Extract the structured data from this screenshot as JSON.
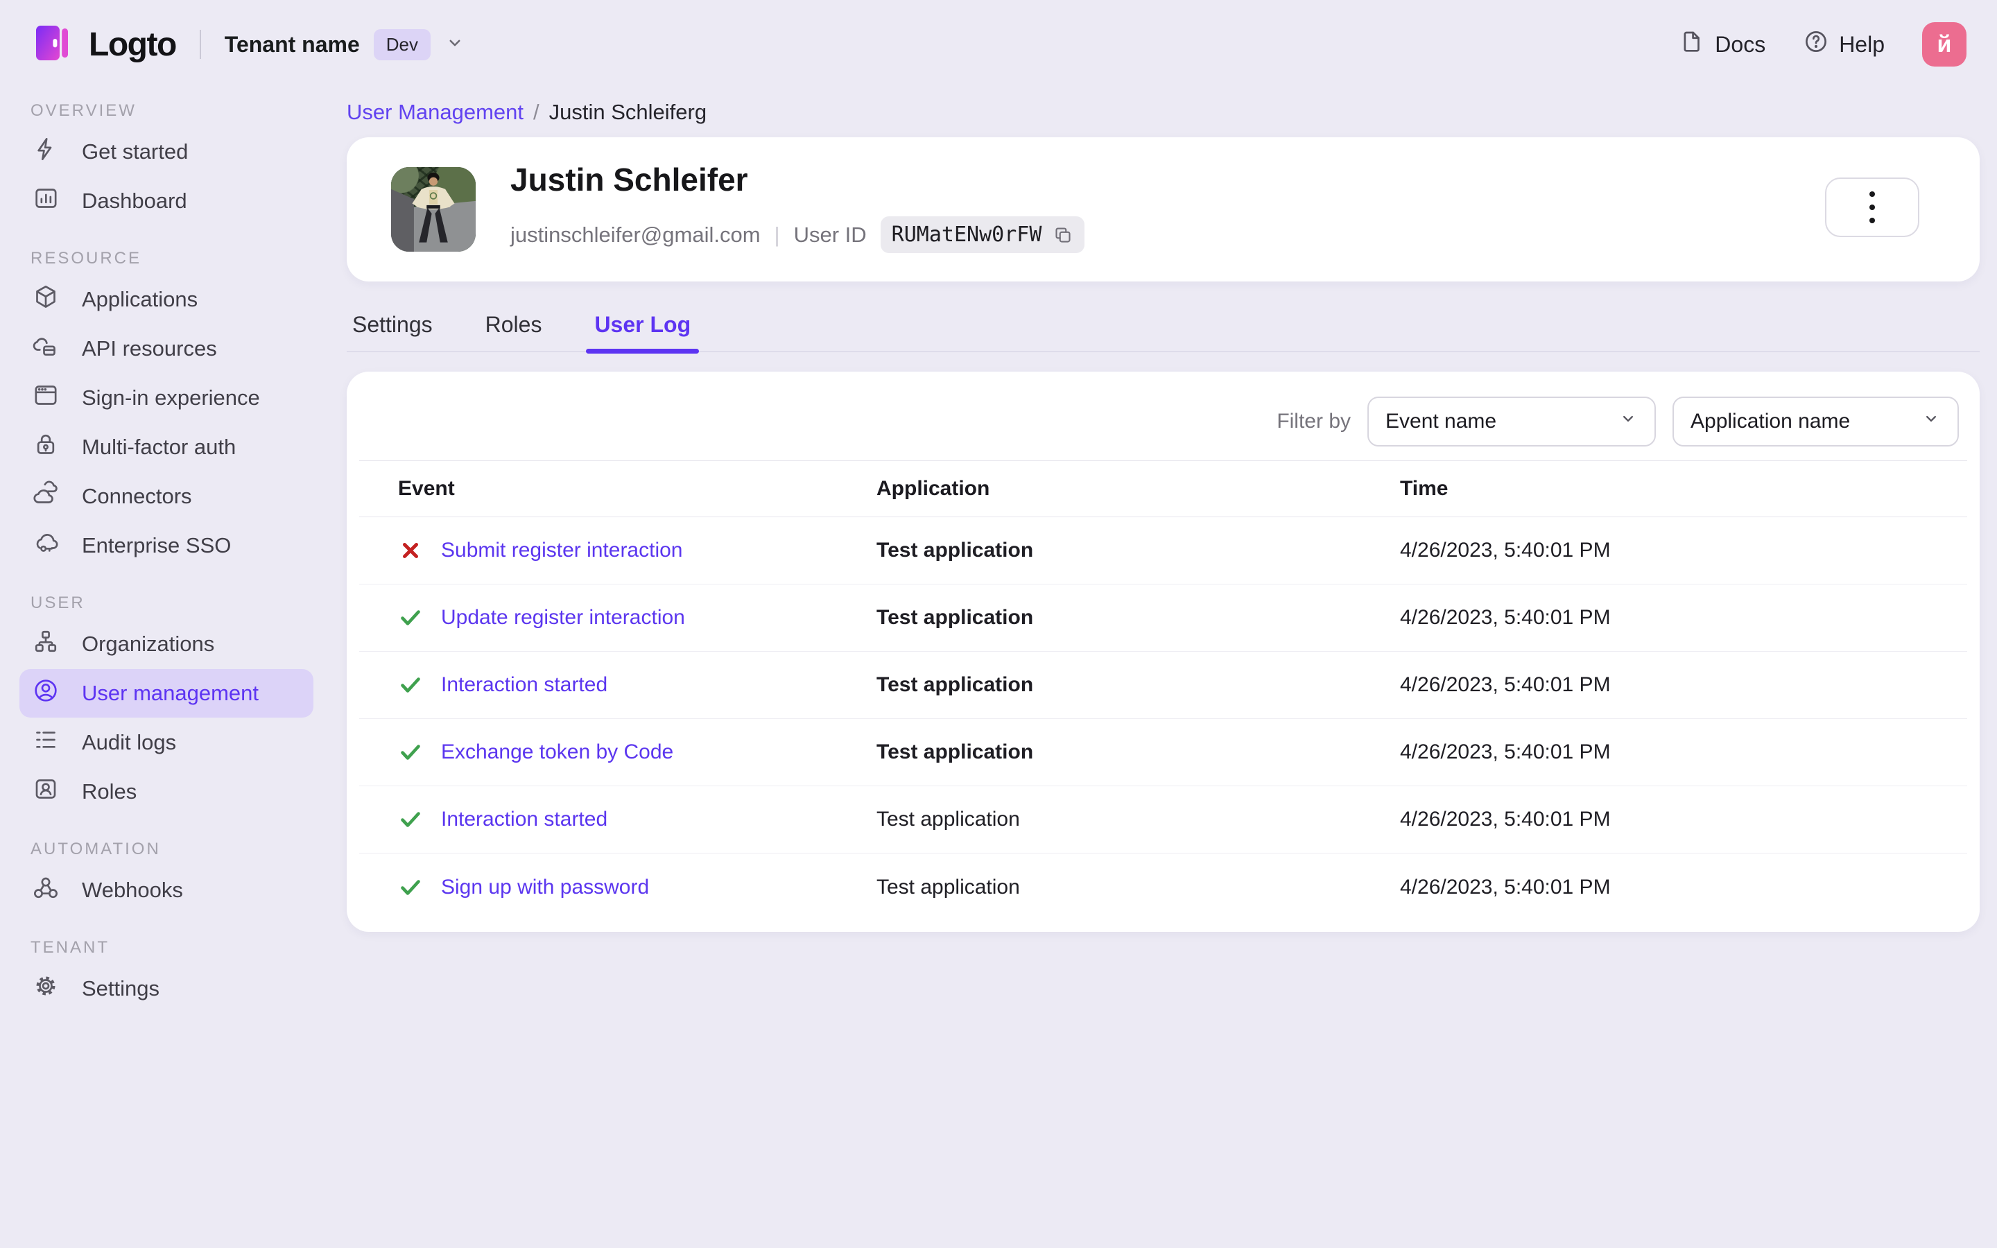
{
  "topbar": {
    "brand": "Logto",
    "tenant_name": "Tenant name",
    "tenant_badge": "Dev",
    "docs_label": "Docs",
    "help_label": "Help",
    "avatar_initial": "й"
  },
  "sidebar": {
    "sections": [
      {
        "label": "OVERVIEW",
        "items": [
          {
            "label": "Get started"
          },
          {
            "label": "Dashboard"
          }
        ]
      },
      {
        "label": "RESOURCE",
        "items": [
          {
            "label": "Applications"
          },
          {
            "label": "API resources"
          },
          {
            "label": "Sign-in experience"
          },
          {
            "label": "Multi-factor auth"
          },
          {
            "label": "Connectors"
          },
          {
            "label": "Enterprise SSO"
          }
        ]
      },
      {
        "label": "USER",
        "items": [
          {
            "label": "Organizations"
          },
          {
            "label": "User management",
            "active": true
          },
          {
            "label": "Audit logs"
          },
          {
            "label": "Roles"
          }
        ]
      },
      {
        "label": "AUTOMATION",
        "items": [
          {
            "label": "Webhooks"
          }
        ]
      },
      {
        "label": "TENANT",
        "items": [
          {
            "label": "Settings"
          }
        ]
      }
    ]
  },
  "breadcrumb": {
    "parent": "User Management",
    "separator": "/",
    "current": "Justin Schleiferg"
  },
  "user_card": {
    "name": "Justin Schleifer",
    "email": "justinschleifer@gmail.com",
    "divider": "|",
    "user_id_label": "User ID",
    "user_id_value": "RUMatENw0rFW"
  },
  "tabs": [
    {
      "label": "Settings"
    },
    {
      "label": "Roles"
    },
    {
      "label": "User Log",
      "active": true
    }
  ],
  "log_panel": {
    "filter_label": "Filter by",
    "event_filter_value": "Event name",
    "application_filter_value": "Application name",
    "table": {
      "headers": [
        "Event",
        "Application",
        "Time"
      ],
      "rows": [
        {
          "status": "error",
          "event": "Submit register interaction",
          "application": "Test application",
          "time": "4/26/2023, 5:40:01 PM"
        },
        {
          "status": "success",
          "event": "Update register interaction",
          "application": "Test application",
          "time": "4/26/2023, 5:40:01 PM"
        },
        {
          "status": "success",
          "event": "Interaction started",
          "application": "Test application",
          "time": "4/26/2023, 5:40:01 PM"
        },
        {
          "status": "success",
          "event": "Exchange token by Code",
          "application": "Test application",
          "time": "4/26/2023, 5:40:01 PM"
        },
        {
          "status": "success",
          "event": "Interaction started",
          "application": "Test application",
          "time": "4/26/2023, 5:40:01 PM"
        },
        {
          "status": "success",
          "event": "Sign up with password",
          "application": "Test application",
          "time": "4/26/2023, 5:40:01 PM"
        }
      ]
    }
  },
  "theme": {
    "accent": "#5D34F2",
    "accent_soft": "#DCD3F8",
    "success": "#3FA14E",
    "error": "#C42222",
    "avatar_bg": "#EC6D90",
    "page_bg": "#ECEAF4"
  }
}
